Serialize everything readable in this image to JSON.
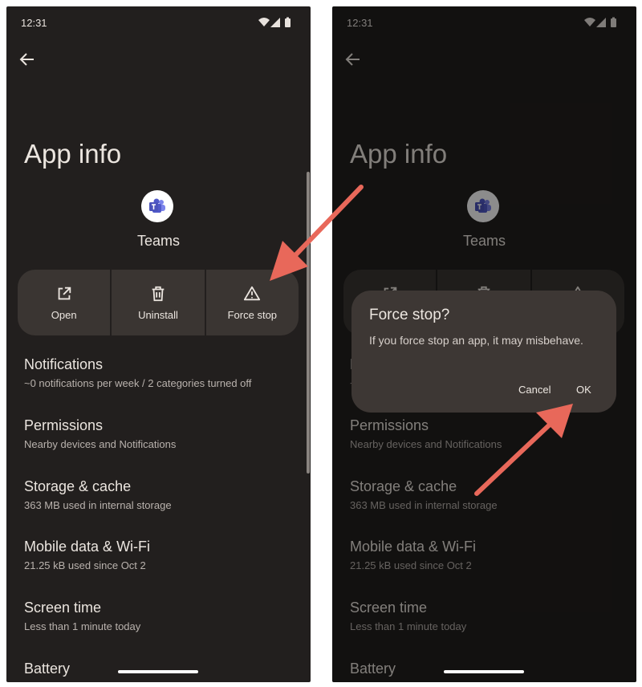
{
  "status": {
    "time": "12:31"
  },
  "screen": {
    "title": "App info"
  },
  "app": {
    "name": "Teams"
  },
  "actions": [
    {
      "label": "Open",
      "icon": "open-external-icon"
    },
    {
      "label": "Uninstall",
      "icon": "trash-icon"
    },
    {
      "label": "Force stop",
      "icon": "warning-icon"
    }
  ],
  "settings": [
    {
      "title": "Notifications",
      "subtitle": "~0 notifications per week / 2 categories turned off"
    },
    {
      "title": "Permissions",
      "subtitle": "Nearby devices and Notifications"
    },
    {
      "title": "Storage & cache",
      "subtitle": "363 MB used in internal storage"
    },
    {
      "title": "Mobile data & Wi-Fi",
      "subtitle": "21.25 kB used since Oct 2"
    },
    {
      "title": "Screen time",
      "subtitle": "Less than 1 minute today"
    },
    {
      "title": "Battery",
      "subtitle": ""
    }
  ],
  "dialog": {
    "title": "Force stop?",
    "message": "If you force stop an app, it may misbehave.",
    "cancel_label": "Cancel",
    "ok_label": "OK"
  },
  "colors": {
    "background": "#221f1e",
    "card": "#3a3532",
    "dialog": "#3d3734",
    "arrow": "#e8685a"
  }
}
